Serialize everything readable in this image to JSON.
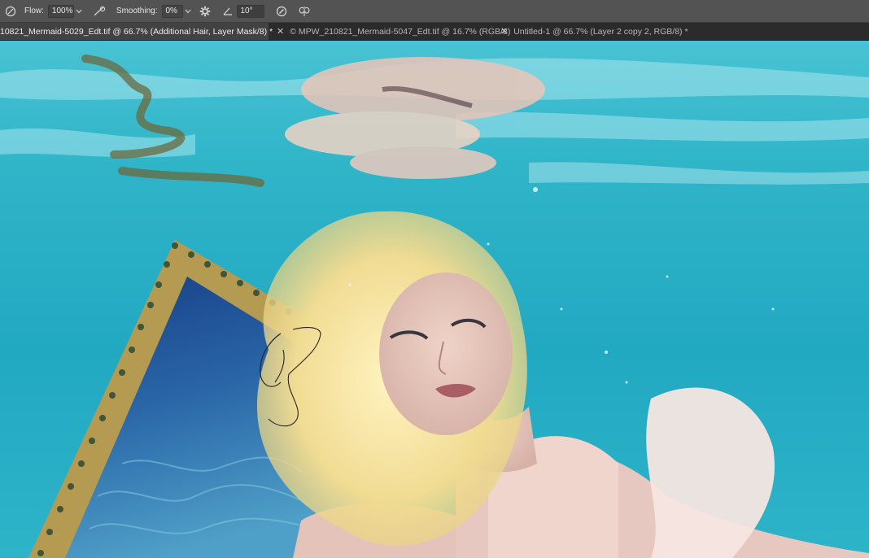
{
  "options_bar": {
    "flow_label": "Flow:",
    "flow_value": "100%",
    "smoothing_label": "Smoothing:",
    "smoothing_value": "0%",
    "angle_value": "10°"
  },
  "tabs": [
    {
      "label": "10821_Mermaid-5029_Edt.tif @ 66.7% (Additional Hair, Layer Mask/8) *",
      "active": true
    },
    {
      "label": "© MPW_210821_Mermaid-5047_Edt.tif @ 16.7% (RGB/8)",
      "active": false
    },
    {
      "label": "Untitled-1 @ 66.7% (Layer 2 copy 2, RGB/8) *",
      "active": false
    }
  ],
  "canvas": {
    "description_icons": [
      "brush-cursor-icon"
    ],
    "colors": {
      "water": "#2fb4c8",
      "water_deep": "#1e9fb8",
      "frame_gold": "#b59a52",
      "hair": "#f3e3a4",
      "skin": "#e8c7bf"
    }
  }
}
